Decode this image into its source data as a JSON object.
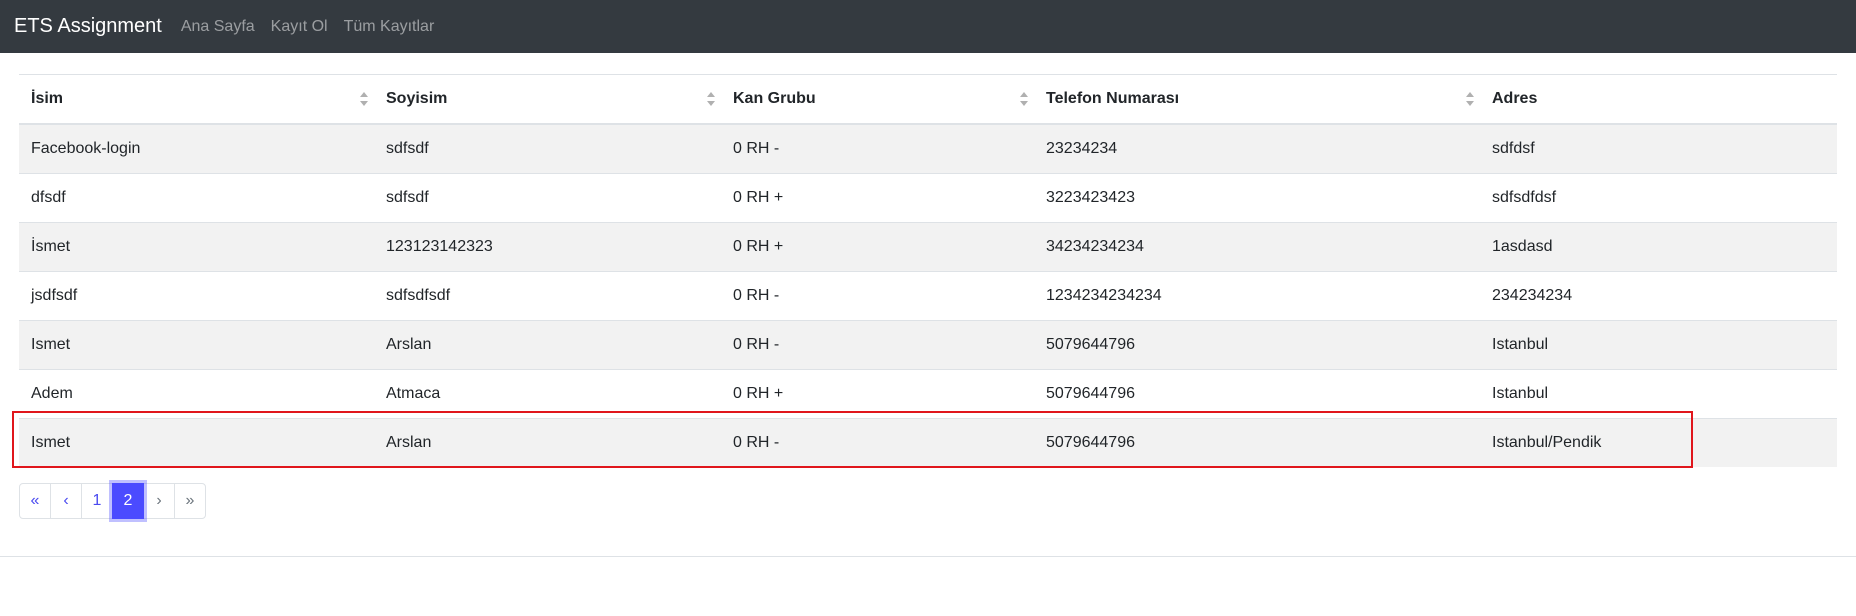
{
  "navbar": {
    "brand": "ETS Assignment",
    "links": [
      "Ana Sayfa",
      "Kayıt Ol",
      "Tüm Kayıtlar"
    ]
  },
  "table": {
    "columns": [
      "İsim",
      "Soyisim",
      "Kan Grubu",
      "Telefon Numarası",
      "Adres"
    ],
    "rows": [
      [
        "Facebook-login",
        "sdfsdf",
        "0 RH -",
        "23234234",
        "sdfdsf"
      ],
      [
        "dfsdf",
        "sdfsdf",
        "0 RH +",
        "3223423423",
        "sdfsdfdsf"
      ],
      [
        "İsmet",
        "123123142323",
        "0 RH +",
        "34234234234",
        "1asdasd"
      ],
      [
        "jsdfsdf",
        "sdfsdfsdf",
        "0 RH -",
        "1234234234234",
        "234234234"
      ],
      [
        "Ismet",
        "Arslan",
        "0 RH -",
        "5079644796",
        "Istanbul"
      ],
      [
        "Adem",
        "Atmaca",
        "0 RH +",
        "5079644796",
        "Istanbul"
      ],
      [
        "Ismet",
        "Arslan",
        "0 RH -",
        "5079644796",
        "Istanbul/Pendik"
      ]
    ]
  },
  "pagination": {
    "first": "«",
    "prev": "‹",
    "pages": [
      "1",
      "2"
    ],
    "active_page": "2",
    "next": "›",
    "last": "»"
  },
  "colors": {
    "navbar_bg": "#343a40",
    "accent": "#4b4bff",
    "highlight": "#e0161c"
  }
}
